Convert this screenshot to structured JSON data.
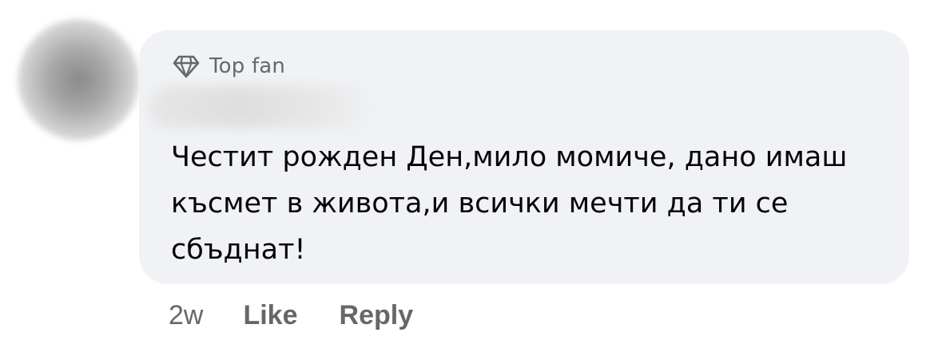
{
  "comment": {
    "badge": {
      "icon": "diamond-icon",
      "label": "Top fan"
    },
    "text": "Честит рожден Ден,мило момиче, дано имаш късмет в живота,и всички мечти да ти се сбъднат!",
    "timestamp": "2w",
    "actions": {
      "like_label": "Like",
      "reply_label": "Reply"
    }
  },
  "colors": {
    "bubble_background": "#f0f2f5",
    "secondary_text": "#65676b",
    "primary_text": "#050505"
  }
}
